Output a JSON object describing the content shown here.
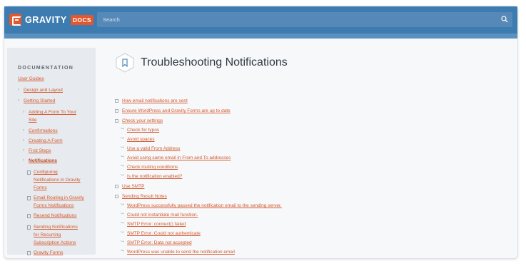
{
  "header": {
    "logo_word": "GRAVITY",
    "logo_badge": "DOCS",
    "search_placeholder": "Search"
  },
  "sidebar": {
    "heading": "DOCUMENTATION",
    "user_guides": "User Guides",
    "design_layout": "Design and Layout",
    "getting_started": "Getting Started",
    "adding_form_1": "Adding A Form To Your",
    "adding_form_2": "Site",
    "confirmations": "Confirmations",
    "creating_form": "Creating A Form",
    "first_steps": "First Steps",
    "notifications": "Notifications",
    "configuring_1": "Configuring",
    "configuring_2": "Notifications in Gravity",
    "configuring_3": "Forms",
    "email_routing_1": "Email Routing in Gravity",
    "email_routing_2": "Forms Notifications",
    "resend": "Resend Notifications",
    "sending_1": "Sending Notifications",
    "sending_2": "for Recurring",
    "sending_3": "Subscription Actions",
    "gravity_forms_1": "Gravity Forms"
  },
  "page": {
    "title": "Troubleshooting Notifications"
  },
  "toc": {
    "i1": "How email notifications are sent",
    "i2": "Ensure WordPress and Gravity Forms are up to date",
    "i3": "Check your settings",
    "s1": "Check for typos",
    "s2": "Avoid spaces",
    "s3": "Use a valid From Address",
    "s4": "Avoid using same email in From and To addresses",
    "s5": "Check routing conditions",
    "s6": "Is the notification enabled?",
    "i4": "Use SMTP",
    "i5": "Sending Result Notes",
    "r1": "WordPress successfully passed the notification email to the sending server.",
    "r2": "Could not instantiate mail function.",
    "r3": "SMTP Error: connect() failed",
    "r4": "SMTP Error: Could not authenticate",
    "r5": "SMTP Error: Data not accepted",
    "r6": "WordPress was unable to send the notification email"
  }
}
